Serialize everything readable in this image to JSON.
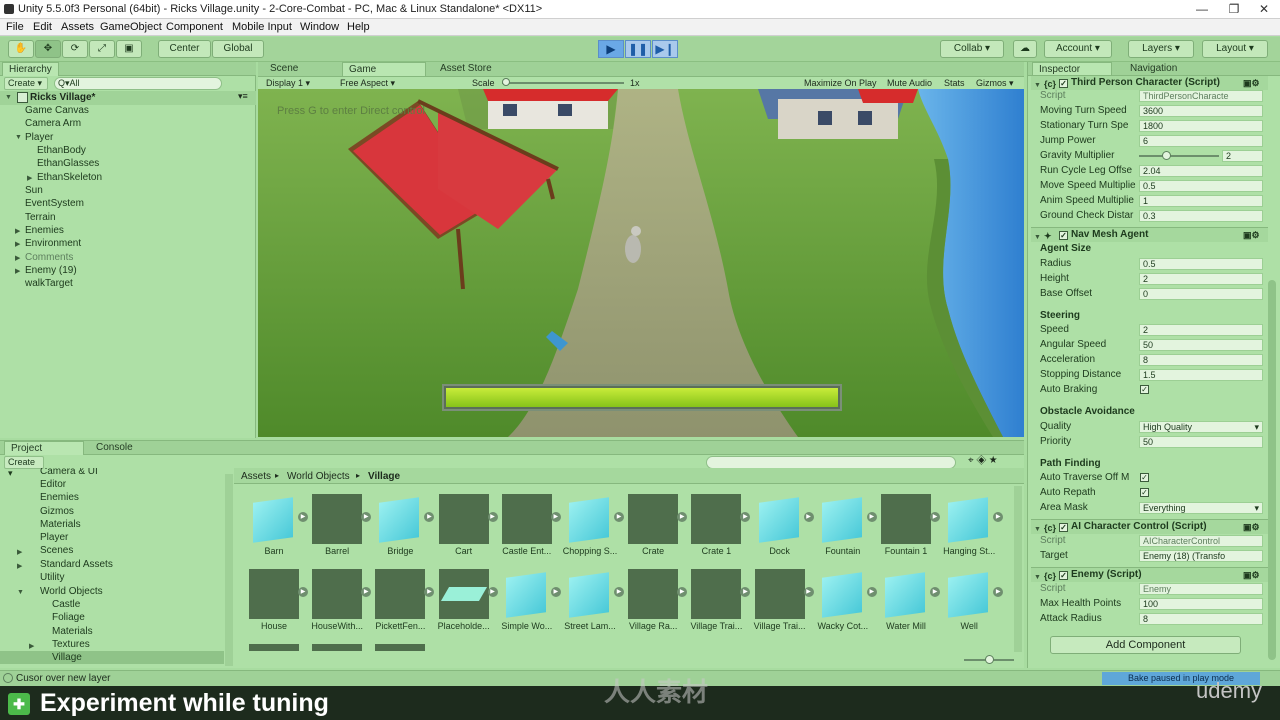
{
  "titlebar": {
    "title": "Unity 5.5.0f3 Personal (64bit) - Ricks Village.unity - 2-Core-Combat - PC, Mac & Linux Standalone* <DX11>",
    "minimize": "—",
    "maximize": "❐",
    "close": "✕"
  },
  "menu": [
    "File",
    "Edit",
    "Assets",
    "GameObject",
    "Component",
    "Mobile Input",
    "Window",
    "Help"
  ],
  "toolbar": {
    "center": "Center",
    "global": "Global",
    "collab": "Collab ▾",
    "account": "Account",
    "layers": "Layers",
    "layout": "Layout"
  },
  "hierarchy": {
    "tab": "Hierarchy",
    "create": "Create ▾",
    "search_placeholder": "Q▾All",
    "scene": "Ricks Village*",
    "items": [
      "Game Canvas",
      "Camera Arm",
      "Player",
      "EthanBody",
      "EthanGlasses",
      "EthanSkeleton",
      "Sun",
      "EventSystem",
      "Terrain",
      "Enemies",
      "Environment",
      "Comments",
      "Enemy (19)",
      "walkTarget"
    ]
  },
  "views": {
    "scene": "Scene",
    "game": "Game",
    "asset_store": "Asset Store"
  },
  "game_bar": {
    "display": "Display 1",
    "aspect": "Free Aspect",
    "scale_label": "Scale",
    "scale_value": "1x",
    "maximize": "Maximize On Play",
    "mute": "Mute Audio",
    "stats": "Stats",
    "gizmos": "Gizmos ▾"
  },
  "game": {
    "hint": "Press G to enter Direct control",
    "health_fraction": 1.0
  },
  "project": {
    "tab": "Project",
    "console_tab": "Console",
    "create": "Create ▾",
    "breadcrumb": [
      "Assets",
      "World Objects",
      "Village"
    ],
    "tree": [
      "Camera & UI",
      "Editor",
      "Enemies",
      "Gizmos",
      "Materials",
      "Player",
      "Scenes",
      "Standard Assets",
      "Utility",
      "World Objects",
      "Castle",
      "Foliage",
      "Materials",
      "Textures",
      "Village"
    ],
    "assets_row1": [
      "Barn",
      "Barrel",
      "Bridge",
      "Cart",
      "Castle Ent...",
      "Chopping S...",
      "Crate",
      "Crate 1",
      "Dock",
      "Fountain",
      "Fountain 1",
      "Hanging St..."
    ],
    "assets_row2": [
      "House",
      "HouseWith...",
      "PickettFen...",
      "Placeholde...",
      "Simple Wo...",
      "Street Lam...",
      "Village Ra...",
      "Village Trai...",
      "Village Trai...",
      "Wacky Cot...",
      "Water Mill",
      "Well"
    ]
  },
  "inspector": {
    "tab": "Inspector",
    "nav_tab": "Navigation",
    "tpc": {
      "title": "Third Person Character (Script)",
      "script_label": "Script",
      "script_value": "ThirdPersonCharacte",
      "fields": [
        {
          "label": "Moving Turn Speed",
          "value": "3600"
        },
        {
          "label": "Stationary Turn Spe",
          "value": "1800"
        },
        {
          "label": "Jump Power",
          "value": "6"
        },
        {
          "label": "Gravity Multiplier",
          "value": "2"
        },
        {
          "label": "Run Cycle Leg Offse",
          "value": "2.04"
        },
        {
          "label": "Move Speed Multiplie",
          "value": "0.5"
        },
        {
          "label": "Anim Speed Multiplie",
          "value": "1"
        },
        {
          "label": "Ground Check Distar",
          "value": "0.3"
        }
      ]
    },
    "nav": {
      "title": "Nav Mesh Agent",
      "agent_size": "Agent Size",
      "size_fields": [
        {
          "label": "Radius",
          "value": "0.5"
        },
        {
          "label": "Height",
          "value": "2"
        },
        {
          "label": "Base Offset",
          "value": "0"
        }
      ],
      "steering": "Steering",
      "steer_fields": [
        {
          "label": "Speed",
          "value": "2"
        },
        {
          "label": "Angular Speed",
          "value": "50"
        },
        {
          "label": "Acceleration",
          "value": "8"
        },
        {
          "label": "Stopping Distance",
          "value": "1.5"
        }
      ],
      "auto_braking": "Auto Braking",
      "obstacle": "Obstacle Avoidance",
      "quality_label": "Quality",
      "quality_value": "High Quality",
      "priority_label": "Priority",
      "priority_value": "50",
      "pathfinding": "Path Finding",
      "auto_traverse": "Auto Traverse Off M",
      "auto_repath": "Auto Repath",
      "area_mask_label": "Area Mask",
      "area_mask_value": "Everything"
    },
    "ai": {
      "title": "AI Character Control (Script)",
      "script_label": "Script",
      "script_value": "AICharacterControl",
      "target_label": "Target",
      "target_value": "Enemy (18) (Transfo"
    },
    "enemy": {
      "title": "Enemy (Script)",
      "script_label": "Script",
      "script_value": "Enemy",
      "health_label": "Max Health Points",
      "health_value": "100",
      "attack_label": "Attack Radius",
      "attack_value": "8"
    },
    "add_component": "Add Component"
  },
  "status": {
    "message": "Cusor over new layer",
    "bake": "Bake paused in play mode"
  },
  "banner": {
    "text": "Experiment while tuning",
    "brand": "udemy",
    "watermark": "人人素材"
  },
  "colors": {
    "accent_green": "#a8dca0",
    "play_blue": "#6aa8e6",
    "health_bar": "#9ad21c"
  }
}
